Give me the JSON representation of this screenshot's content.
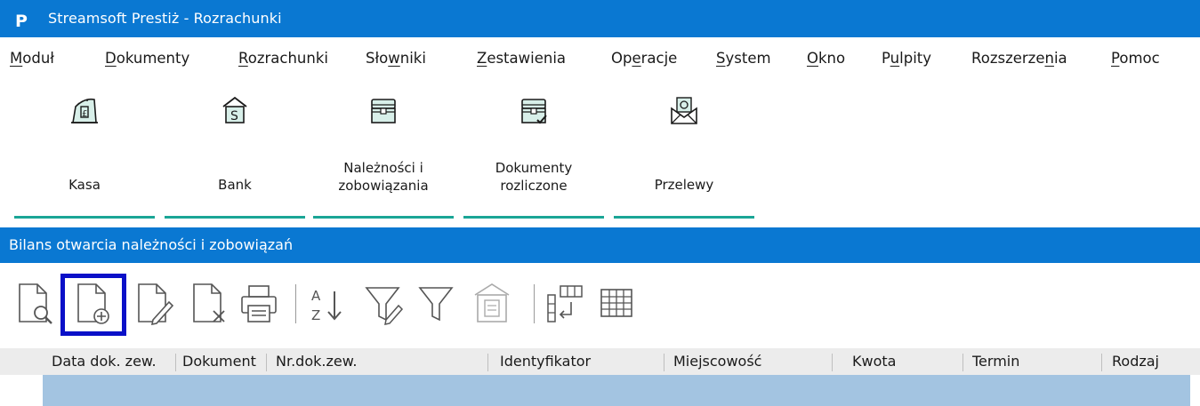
{
  "window": {
    "logo_letter": "P",
    "title": "Streamsoft Prestiż - Rozrachunki",
    "accent": "#0a78d2"
  },
  "menu": [
    {
      "pre": "",
      "u": "M",
      "post": "oduł"
    },
    {
      "pre": "",
      "u": "D",
      "post": "okumenty"
    },
    {
      "pre": "",
      "u": "R",
      "post": "ozrachunki"
    },
    {
      "pre": "Sło",
      "u": "w",
      "post": "niki"
    },
    {
      "pre": "",
      "u": "Z",
      "post": "estawienia"
    },
    {
      "pre": "Op",
      "u": "e",
      "post": "racje"
    },
    {
      "pre": "",
      "u": "S",
      "post": "ystem"
    },
    {
      "pre": "",
      "u": "O",
      "post": "kno"
    },
    {
      "pre": "P",
      "u": "u",
      "post": "lpity"
    },
    {
      "pre": "Rozszerze",
      "u": "n",
      "post": "ia"
    },
    {
      "pre": "",
      "u": "P",
      "post": "omoc"
    }
  ],
  "ribbon": {
    "buttons": [
      {
        "line1": "Kasa",
        "line2": "",
        "icon": "cash-register-icon"
      },
      {
        "line1": "Bank",
        "line2": "",
        "icon": "bank-icon"
      },
      {
        "line1": "Należności i",
        "line2": "zobowiązania",
        "icon": "chest-icon"
      },
      {
        "line1": "Dokumenty",
        "line2": "rozliczone",
        "icon": "chest-check-icon"
      },
      {
        "line1": "Przelewy",
        "line2": "",
        "icon": "money-envelope-icon"
      }
    ],
    "underline_color": "#1aa596"
  },
  "panel": {
    "title": "Bilans otwarcia należności i zobowiązań"
  },
  "toolbar": {
    "buttons": [
      "preview-document-icon",
      "add-document-icon",
      "edit-document-icon",
      "delete-document-icon",
      "print-icon",
      "sort-az-icon",
      "filter-edit-icon",
      "filter-icon",
      "archive-document-icon",
      "column-layout-icon",
      "grid-icon"
    ],
    "selected": "add-document-icon",
    "selection_color": "#0a10c8"
  },
  "grid": {
    "columns": [
      "Data dok. zew.",
      "Dokument",
      "Nr.dok.zew.",
      "Identyfikator",
      "Miejscowość",
      "Kwota",
      "Termin",
      "Rodzaj"
    ],
    "selected_row_color": "#a3c4e1"
  }
}
